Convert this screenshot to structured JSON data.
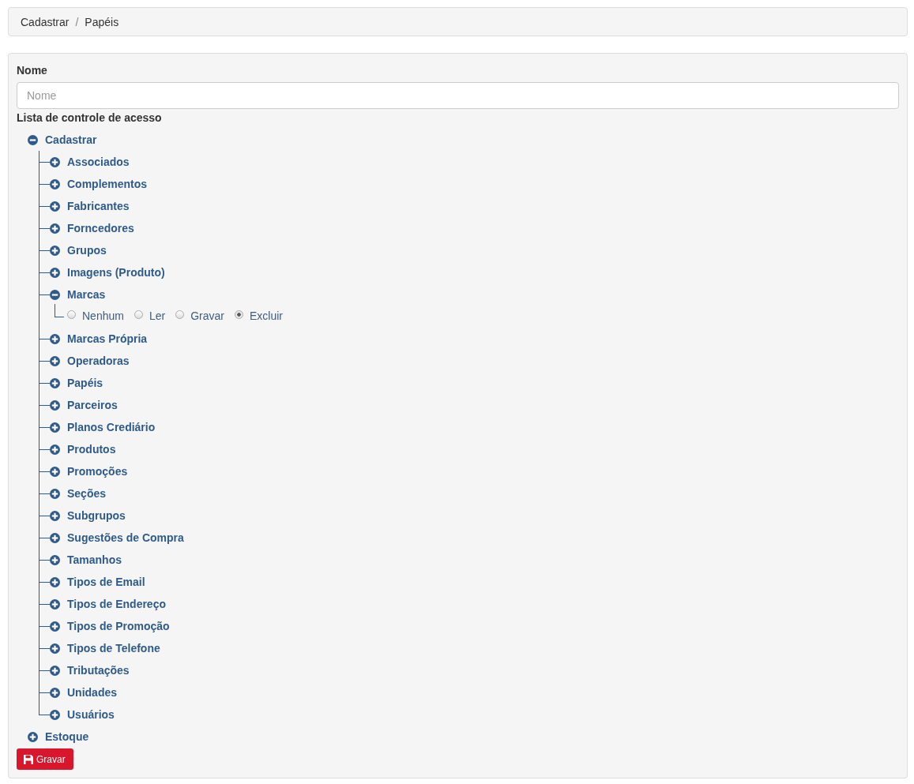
{
  "breadcrumb": {
    "separator": "/",
    "items": [
      {
        "label": "Cadastrar"
      },
      {
        "label": "Papéis"
      }
    ]
  },
  "name_field": {
    "label": "Nome",
    "placeholder": "Nome"
  },
  "acl": {
    "label": "Lista de controle de acesso",
    "tree": [
      {
        "label": "Cadastrar",
        "expanded": true,
        "children": [
          {
            "label": "Associados",
            "expanded": false
          },
          {
            "label": "Complementos",
            "expanded": false
          },
          {
            "label": "Fabricantes",
            "expanded": false
          },
          {
            "label": "Forncedores",
            "expanded": false
          },
          {
            "label": "Grupos",
            "expanded": false
          },
          {
            "label": "Imagens (Produto)",
            "expanded": false
          },
          {
            "label": "Marcas",
            "expanded": true,
            "options": [
              {
                "label": "Nenhum",
                "selected": false
              },
              {
                "label": "Ler",
                "selected": false
              },
              {
                "label": "Gravar",
                "selected": false
              },
              {
                "label": "Excluir",
                "selected": true
              }
            ]
          },
          {
            "label": "Marcas Própria",
            "expanded": false
          },
          {
            "label": "Operadoras",
            "expanded": false
          },
          {
            "label": "Papéis",
            "expanded": false
          },
          {
            "label": "Parceiros",
            "expanded": false
          },
          {
            "label": "Planos Crediário",
            "expanded": false
          },
          {
            "label": "Produtos",
            "expanded": false
          },
          {
            "label": "Promoções",
            "expanded": false
          },
          {
            "label": "Seções",
            "expanded": false
          },
          {
            "label": "Subgrupos",
            "expanded": false
          },
          {
            "label": "Sugestões de Compra",
            "expanded": false
          },
          {
            "label": "Tamanhos",
            "expanded": false
          },
          {
            "label": "Tipos de Email",
            "expanded": false
          },
          {
            "label": "Tipos de Endereço",
            "expanded": false
          },
          {
            "label": "Tipos de Promoção",
            "expanded": false
          },
          {
            "label": "Tipos de Telefone",
            "expanded": false
          },
          {
            "label": "Tributações",
            "expanded": false
          },
          {
            "label": "Unidades",
            "expanded": false
          },
          {
            "label": "Usuários",
            "expanded": false
          }
        ]
      },
      {
        "label": "Estoque",
        "expanded": false
      }
    ]
  },
  "save_button": {
    "label": "Gravar"
  }
}
